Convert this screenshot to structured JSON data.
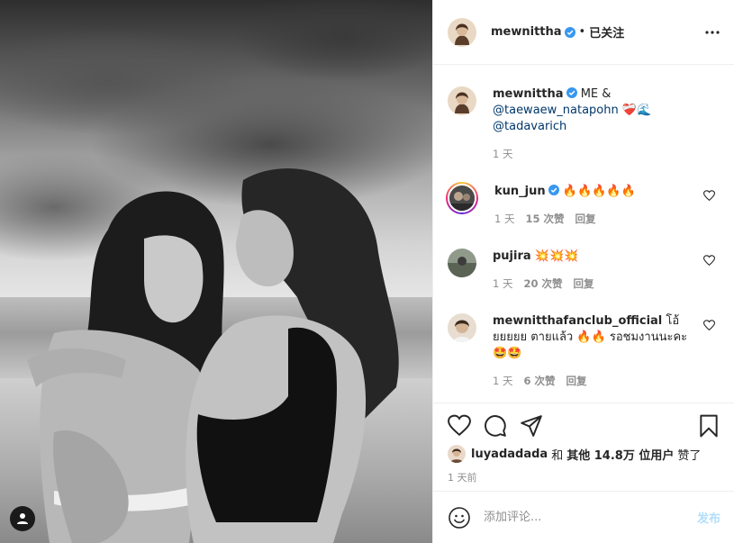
{
  "post": {
    "image_alt": "Black-and-white beach photo of two women",
    "tag_icon": "user-tag-icon"
  },
  "header": {
    "username": "mewnittha",
    "verified": true,
    "separator": "•",
    "follow_label": "已关注",
    "more_icon": "more-options-icon"
  },
  "caption": {
    "username": "mewnittha",
    "text": "ME &",
    "mention1": "@taewaew_natapohn",
    "emoji": "❤️‍🩹🌊",
    "mention2": "@tadavarich",
    "time": "1 天"
  },
  "comments": [
    {
      "username": "kun_jun",
      "verified": true,
      "text": "🔥🔥🔥🔥🔥",
      "time": "1 天",
      "likes": "15 次赞",
      "reply": "回复"
    },
    {
      "username": "pujira",
      "verified": false,
      "text": "💥💥💥",
      "time": "1 天",
      "likes": "20 次赞",
      "reply": "回复"
    },
    {
      "username": "mewnitthafanclub_official",
      "verified": false,
      "text": "โอ้ยยยยย ตายแล้ว 🔥🔥 รอชมงานนะคะ 🤩🤩",
      "time": "1 天",
      "likes": "6 次赞",
      "reply": "回复"
    }
  ],
  "actions": {
    "like_icon": "heart-icon",
    "comment_icon": "comment-icon",
    "share_icon": "share-icon",
    "save_icon": "bookmark-icon"
  },
  "likes": {
    "first_user": "luyadadada",
    "and": "和",
    "others": "其他 14.8万 位用户",
    "suffix": "赞了"
  },
  "time_ago": "1 天前",
  "add_comment": {
    "placeholder": "添加评论...",
    "post_label": "发布",
    "emoji_icon": "emoji-icon"
  },
  "colors": {
    "link": "#00376b",
    "verified": "#3897f0",
    "secondary_text": "#8e8e8e",
    "post_disabled": "#b2dffc"
  }
}
